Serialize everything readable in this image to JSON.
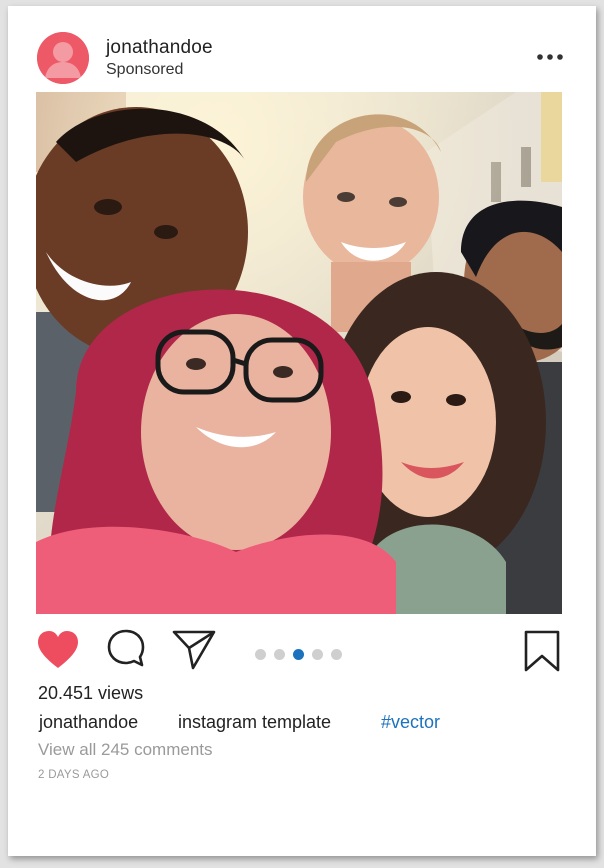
{
  "post": {
    "username": "jonathandoe",
    "sponsored_label": "Sponsored",
    "views": "20.451 views",
    "caption_user": "jonathandoe",
    "caption_text": "instagram template",
    "hashtag": "#vector",
    "comments_link": "View all 245 comments",
    "timestamp": "2 DAYS AGO",
    "carousel": {
      "total": 5,
      "active_index": 2
    }
  },
  "icons": {
    "avatar": "user-avatar-icon",
    "more": "more-dots-icon",
    "like": "heart-icon",
    "comment": "comment-icon",
    "share": "paper-plane-icon",
    "save": "bookmark-icon"
  },
  "colors": {
    "like": "#ee4d5f",
    "avatar_bg": "#ee5968",
    "hashtag": "#1c72bd",
    "active_dot": "#1c72bd",
    "inactive_dot": "#cfcfcf",
    "muted_text": "#9a9a9a"
  }
}
